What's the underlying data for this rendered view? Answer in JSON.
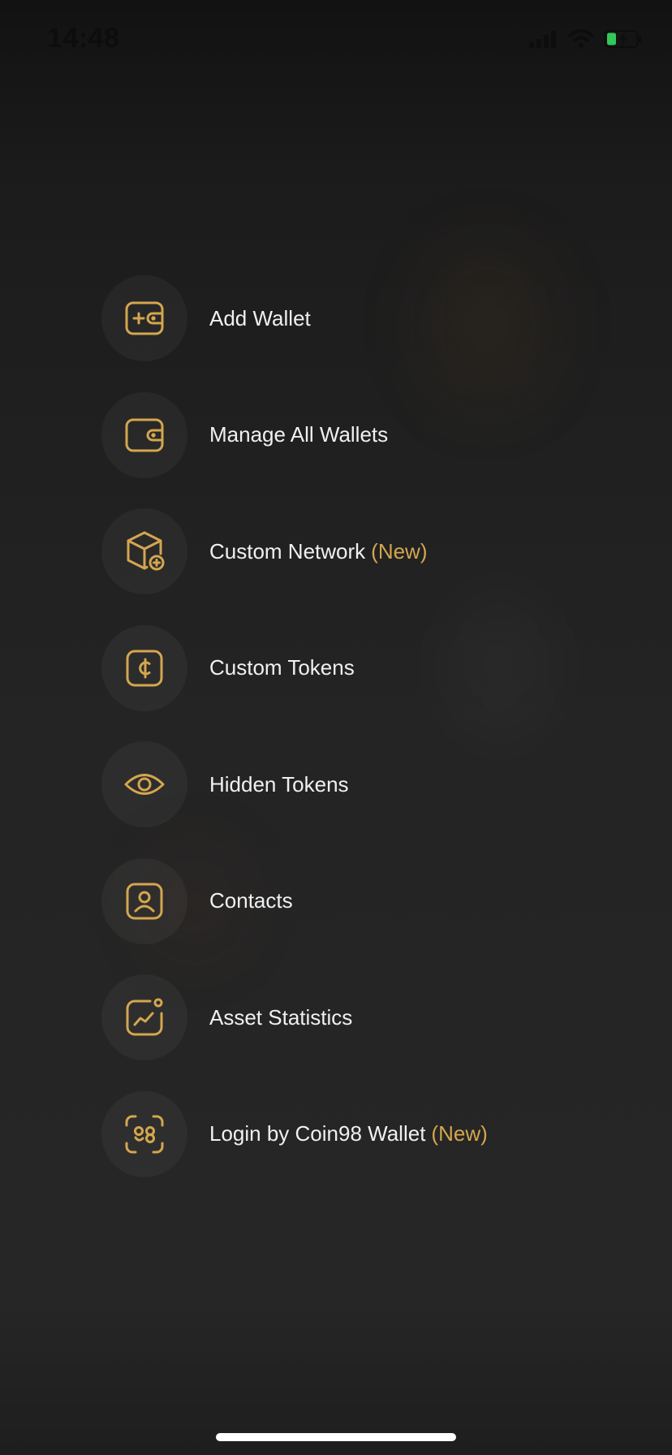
{
  "status_bar": {
    "time": "14:48"
  },
  "menu": {
    "items": [
      {
        "label": "Add Wallet",
        "badge": "",
        "icon": "add-wallet-icon"
      },
      {
        "label": "Manage All Wallets",
        "badge": "",
        "icon": "wallet-icon"
      },
      {
        "label": "Custom Network",
        "badge": "(New)",
        "icon": "cube-plus-icon"
      },
      {
        "label": "Custom Tokens",
        "badge": "",
        "icon": "coin-icon"
      },
      {
        "label": "Hidden Tokens",
        "badge": "",
        "icon": "eye-icon"
      },
      {
        "label": "Contacts",
        "badge": "",
        "icon": "contact-icon"
      },
      {
        "label": "Asset Statistics",
        "badge": "",
        "icon": "chart-icon"
      },
      {
        "label": "Login by Coin98 Wallet",
        "badge": "(New)",
        "icon": "scan-icon"
      }
    ]
  },
  "colors": {
    "accent": "#d4a64f",
    "background": "#242424",
    "text": "#f0f0f0"
  }
}
